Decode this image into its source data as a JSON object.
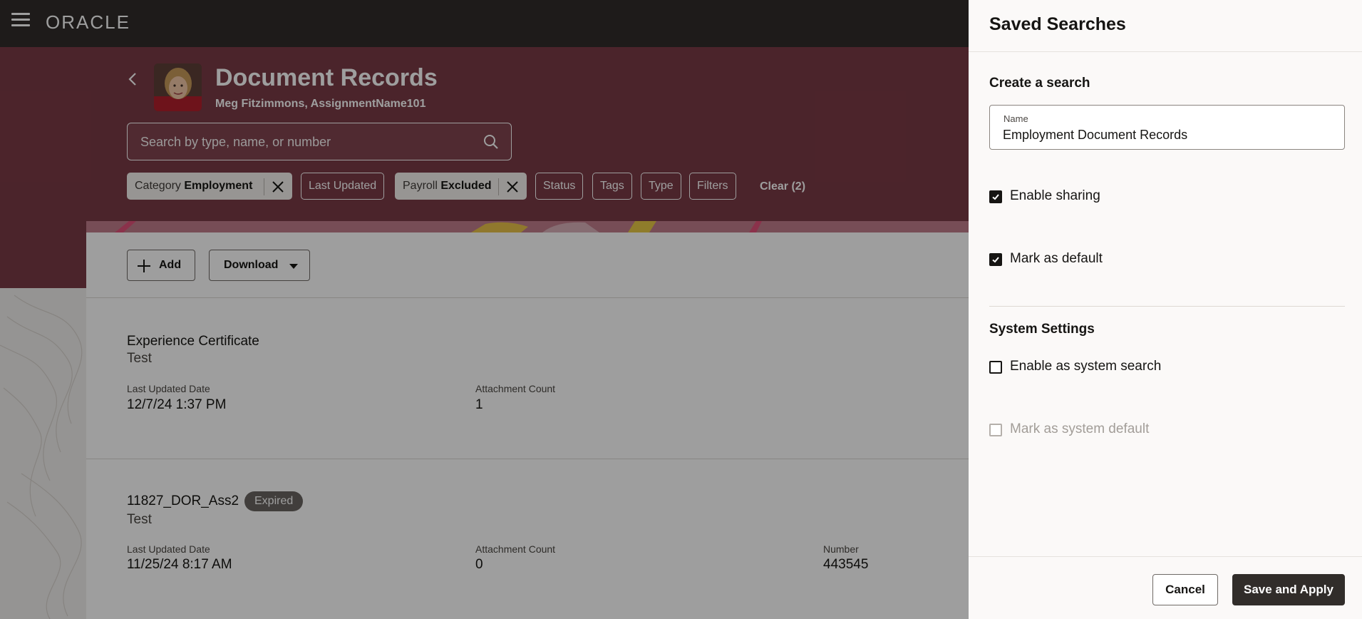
{
  "header": {
    "logo_text": "ORACLE"
  },
  "page": {
    "title": "Document Records",
    "subtitle": "Meg Fitzimmons, AssignmentName101",
    "search_placeholder": "Search by type, name, or number"
  },
  "filters": {
    "chips": [
      {
        "label": "Category",
        "value": "Employment",
        "selected": true
      },
      {
        "label": "Last Updated"
      },
      {
        "label": "Payroll",
        "value": "Excluded",
        "selected": true
      },
      {
        "label": "Status"
      },
      {
        "label": "Tags"
      },
      {
        "label": "Type"
      },
      {
        "label": "Filters"
      }
    ],
    "clear_label": "Clear (2)"
  },
  "toolbar": {
    "add_label": "Add",
    "download_label": "Download"
  },
  "records": [
    {
      "title": "Experience Certificate",
      "subtitle": "Test",
      "last_updated_label": "Last Updated Date",
      "last_updated": "12/7/24 1:37 PM",
      "attachment_label": "Attachment Count",
      "attachment_count": "1"
    },
    {
      "title": "11827_DOR_Ass2",
      "badge": "Expired",
      "subtitle": "Test",
      "last_updated_label": "Last Updated Date",
      "last_updated": "11/25/24 8:17 AM",
      "attachment_label": "Attachment Count",
      "attachment_count": "0",
      "number_label": "Number",
      "number": "443545"
    }
  ],
  "drawer": {
    "title": "Saved Searches",
    "create_title": "Create a search",
    "name_label": "Name",
    "name_value": "Employment Document Records",
    "enable_sharing": {
      "label": "Enable sharing",
      "checked": true
    },
    "mark_default": {
      "label": "Mark as default",
      "checked": true
    },
    "system_title": "System Settings",
    "system_search": {
      "label": "Enable as system search",
      "checked": false
    },
    "system_default": {
      "label": "Mark as system default",
      "checked": false,
      "disabled": true
    },
    "cancel_label": "Cancel",
    "save_label": "Save and Apply"
  },
  "colors": {
    "header_bg": "#312d2a",
    "hero_bg": "#7a3a46",
    "primary_button": "#312d2a",
    "overlay": "rgba(0,0,0,0.38)"
  }
}
